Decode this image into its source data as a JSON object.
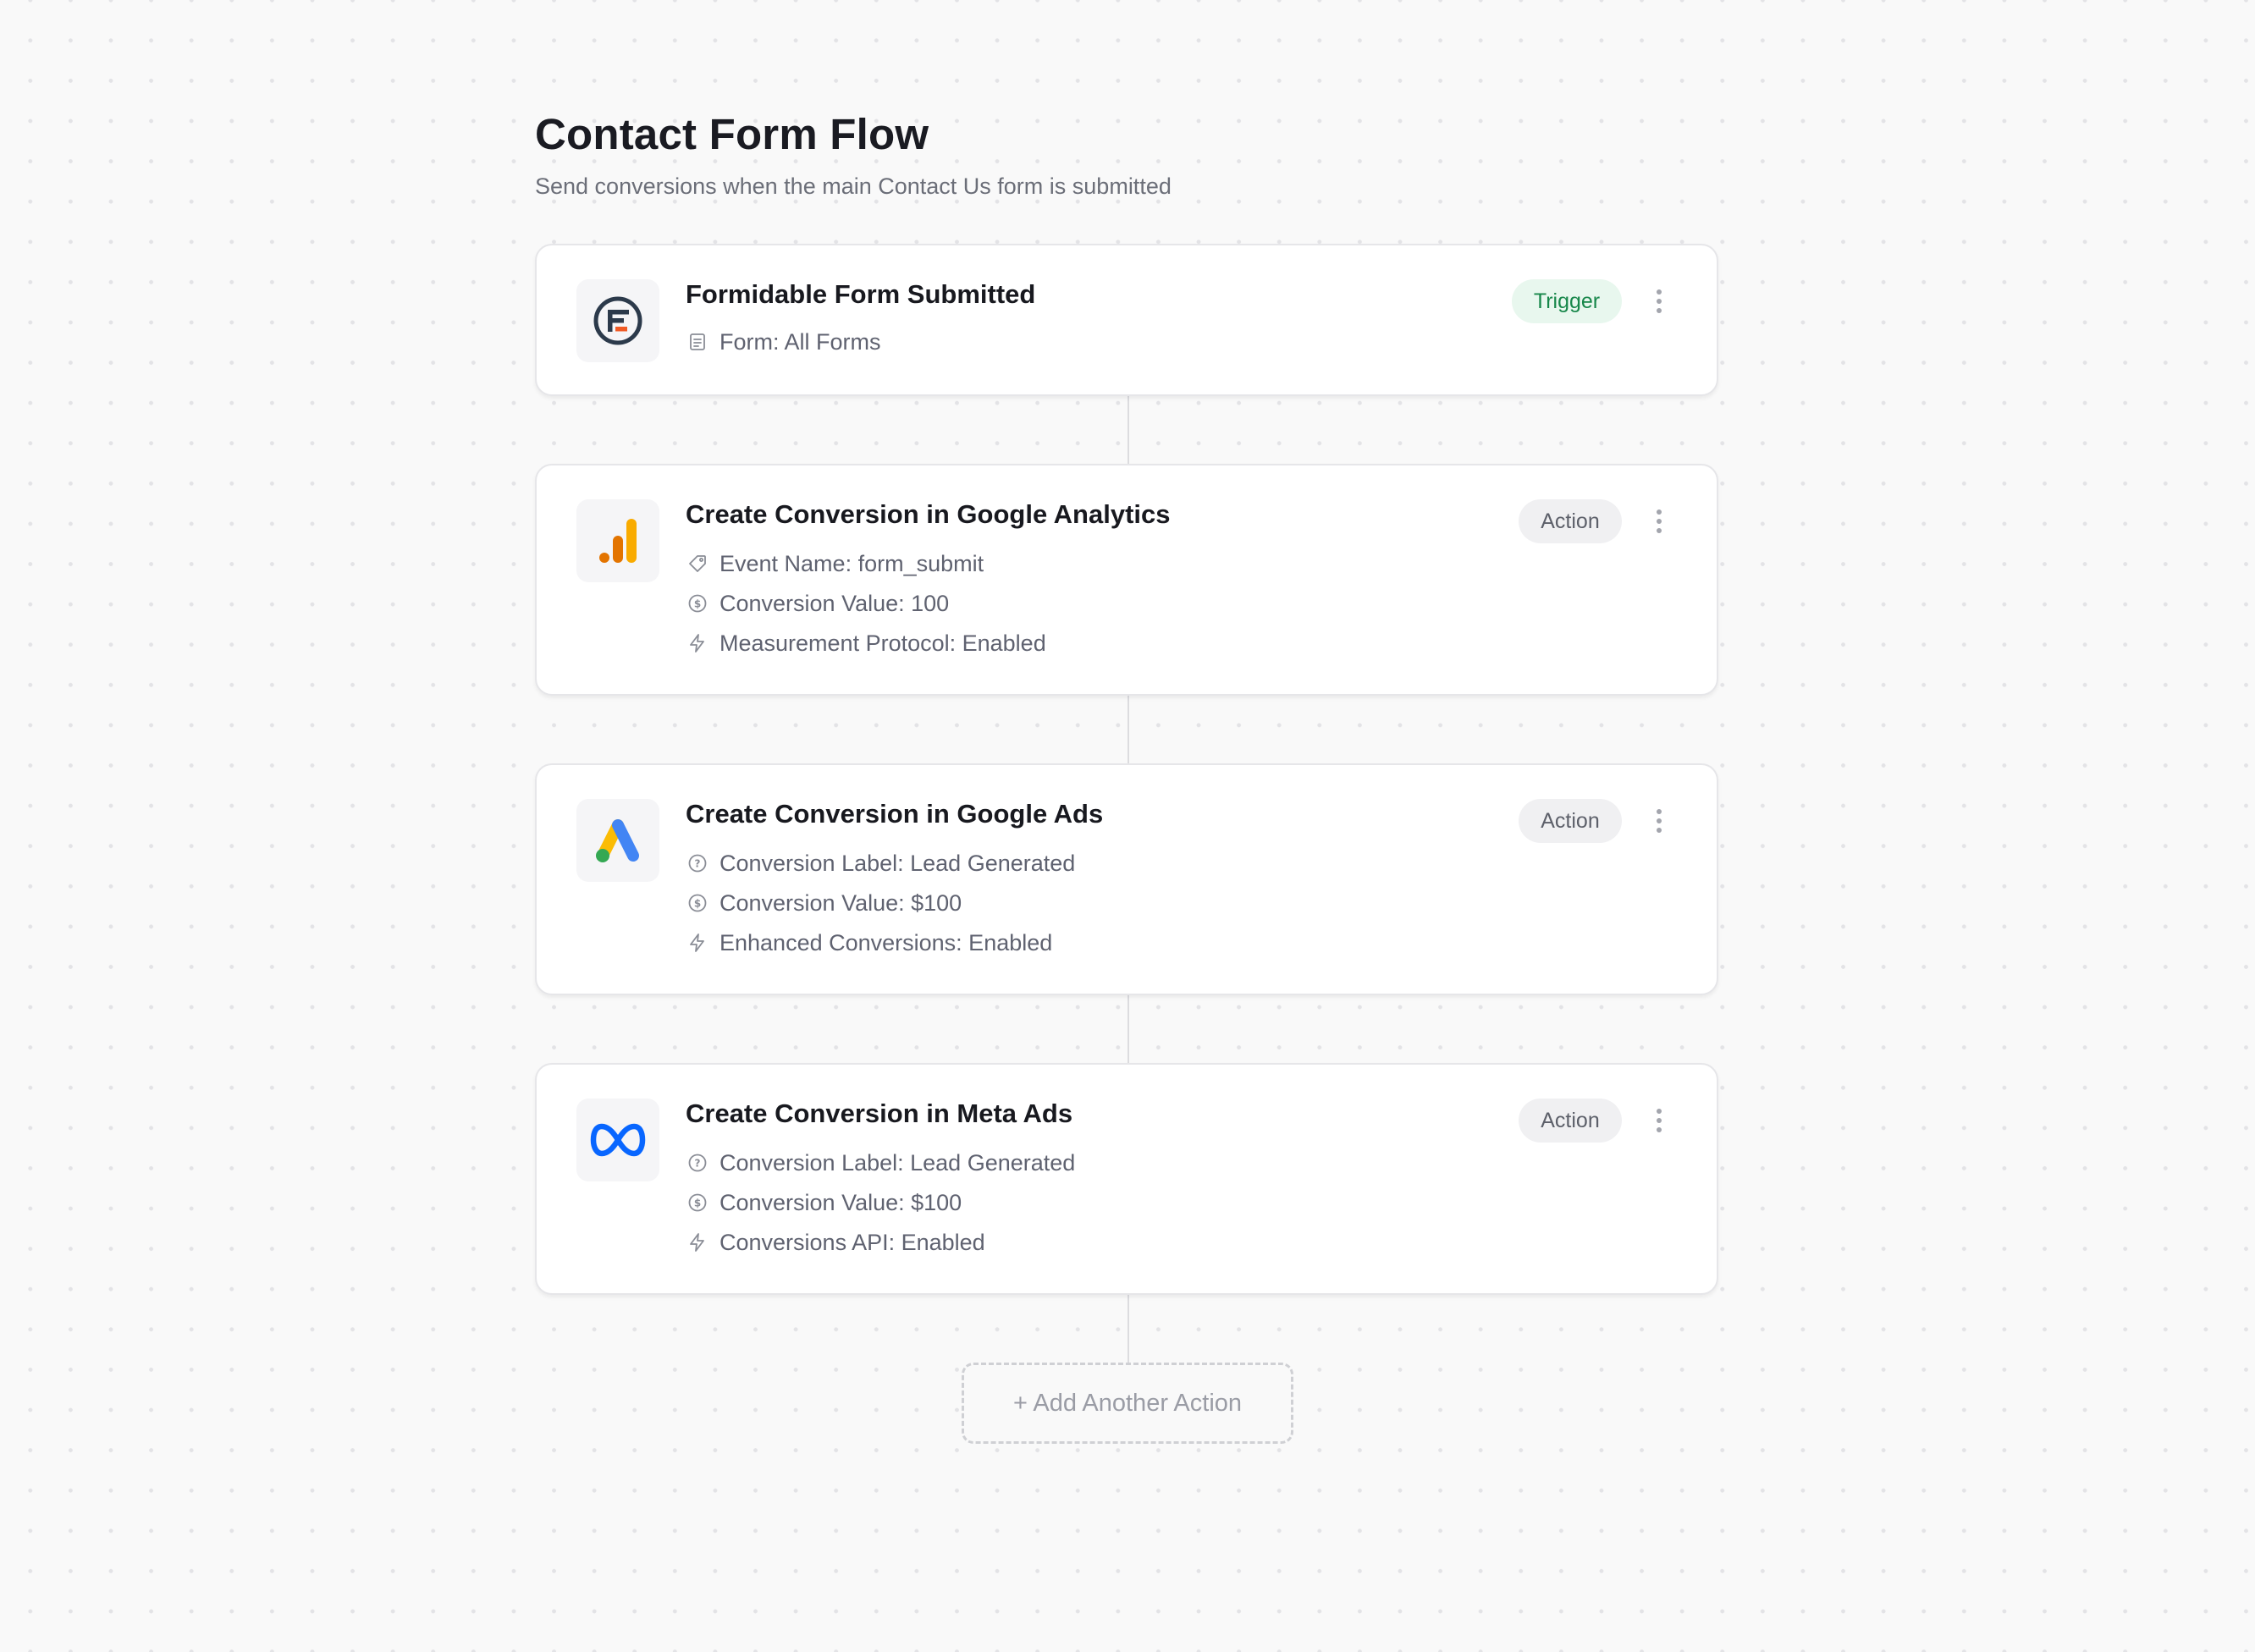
{
  "page": {
    "title": "Contact Form Flow",
    "subtitle": "Send conversions when the main Contact Us form is submitted"
  },
  "steps": [
    {
      "app": "Formidable Forms",
      "icon": "formidable-logo-icon",
      "title": "Formidable Form Submitted",
      "badge": "Trigger",
      "details": [
        {
          "icon": "document-icon",
          "text": "Form: All Forms"
        }
      ]
    },
    {
      "app": "Google Analytics",
      "icon": "google-analytics-logo-icon",
      "title": "Create Conversion in Google Analytics",
      "badge": "Action",
      "details": [
        {
          "icon": "tag-icon",
          "text": "Event Name: form_submit"
        },
        {
          "icon": "dollar-circle-icon",
          "text": "Conversion Value: 100"
        },
        {
          "icon": "lightning-icon",
          "text": "Measurement Protocol: Enabled"
        }
      ]
    },
    {
      "app": "Google Ads",
      "icon": "google-ads-logo-icon",
      "title": "Create Conversion in Google Ads",
      "badge": "Action",
      "details": [
        {
          "icon": "question-circle-icon",
          "text": "Conversion Label: Lead Generated"
        },
        {
          "icon": "dollar-circle-icon",
          "text": "Conversion Value: $100"
        },
        {
          "icon": "lightning-icon",
          "text": "Enhanced Conversions: Enabled"
        }
      ]
    },
    {
      "app": "Meta Ads",
      "icon": "meta-logo-icon",
      "title": "Create Conversion in Meta Ads",
      "badge": "Action",
      "details": [
        {
          "icon": "question-circle-icon",
          "text": "Conversion Label: Lead Generated"
        },
        {
          "icon": "dollar-circle-icon",
          "text": "Conversion Value: $100"
        },
        {
          "icon": "lightning-icon",
          "text": "Conversions API: Enabled"
        }
      ]
    }
  ],
  "add_action": {
    "label": "+ Add Another Action"
  },
  "colors": {
    "trigger_badge_bg": "#e8f7ee",
    "trigger_badge_text": "#17874a",
    "action_badge_bg": "#f0f0f2",
    "action_badge_text": "#5d606a",
    "formidable_navy": "#2c3a4b",
    "formidable_orange": "#f05a24",
    "analytics_orange": "#f9ab00",
    "analytics_dark_orange": "#e37400",
    "ads_blue": "#4285f4",
    "ads_yellow": "#fbbc04",
    "ads_green": "#34a853",
    "meta_blue": "#0866ff"
  }
}
